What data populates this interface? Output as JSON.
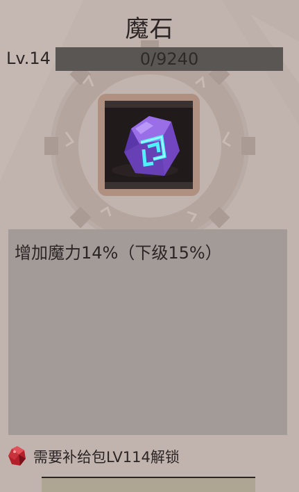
{
  "item": {
    "title": "魔石",
    "level": "Lv.14",
    "exp_text": "0/9240",
    "exp_progress": 0,
    "icon": "magic-stone-icon",
    "description": "增加魔力14%（下级15%）"
  },
  "unlock": {
    "icon": "red-gem-icon",
    "text": "需要补给包LV114解锁"
  },
  "colors": {
    "background": "#c1b3ad",
    "panel": "#a29b98",
    "exp_bar": "#5a5654",
    "frame": "#b09080",
    "gem_purple": "#8a5cd6",
    "rune_cyan": "#4ef2ff",
    "unlock_red": "#b3202a"
  }
}
